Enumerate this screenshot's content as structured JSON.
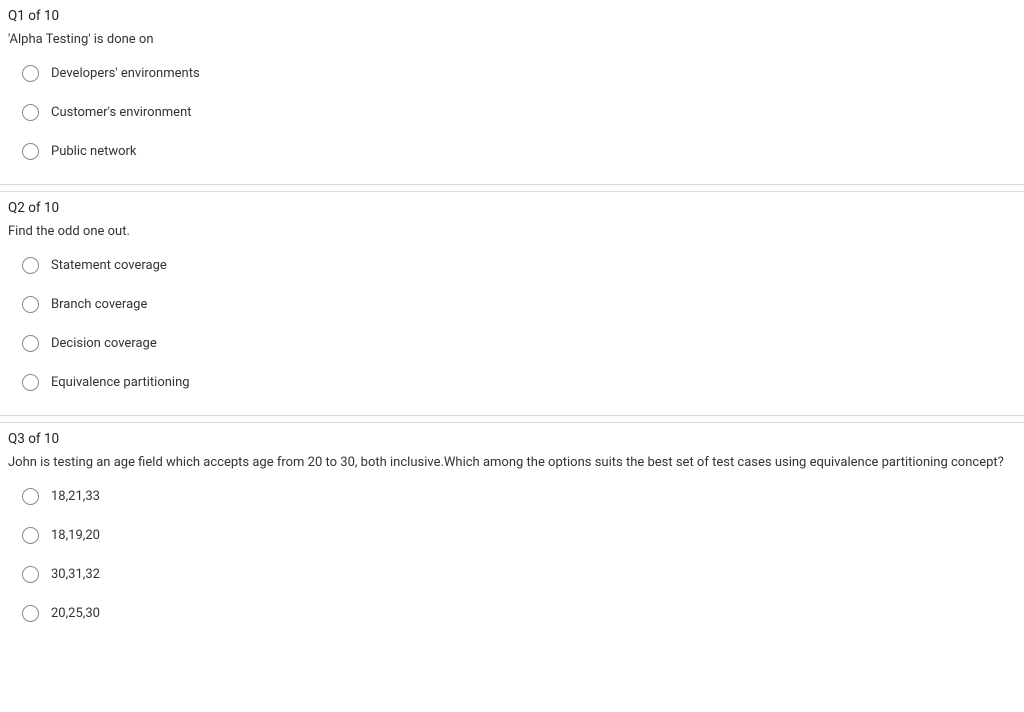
{
  "questions": [
    {
      "header": "Q1 of 10",
      "prompt": "'Alpha Testing' is done on",
      "options": [
        "Developers' environments",
        "Customer's environment",
        "Public network"
      ]
    },
    {
      "header": "Q2 of 10",
      "prompt": "Find the odd one out.",
      "options": [
        "Statement coverage",
        "Branch coverage",
        "Decision coverage",
        "Equivalence partitioning"
      ]
    },
    {
      "header": "Q3 of 10",
      "prompt": "John is testing an age field which accepts age from 20 to 30, both inclusive.Which among the options suits the best set of test cases using equivalence partitioning concept?",
      "options": [
        "18,21,33",
        "18,19,20",
        "30,31,32",
        "20,25,30"
      ]
    }
  ]
}
